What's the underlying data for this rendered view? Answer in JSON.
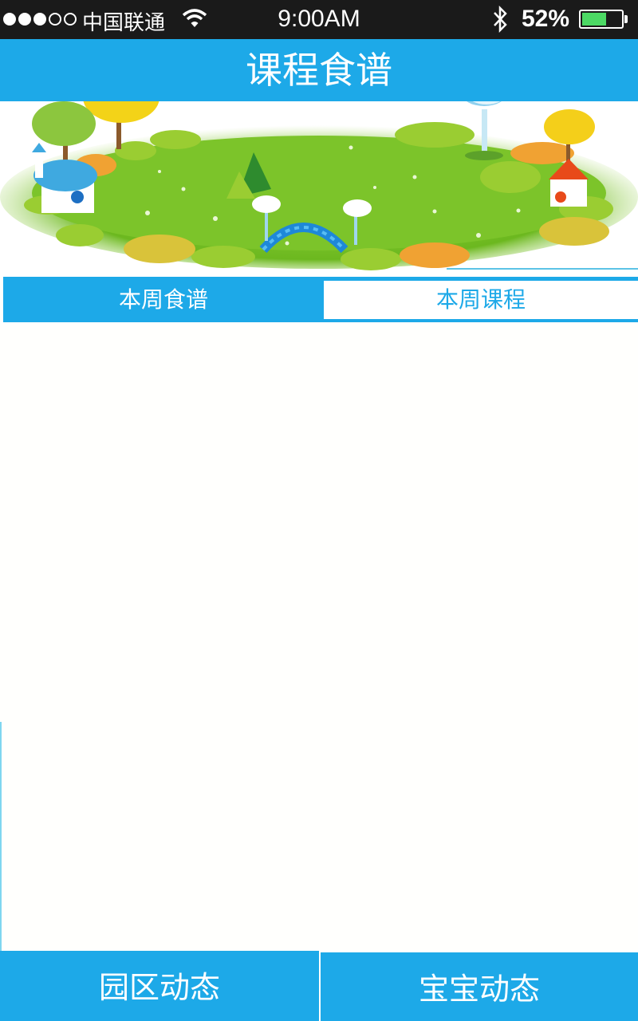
{
  "status_bar": {
    "carrier": "中国联通",
    "time": "9:00AM",
    "battery_percent": "52%",
    "battery_level": 0.62,
    "signal_bars": 3,
    "signal_total": 5
  },
  "header": {
    "title": "课程食谱"
  },
  "tabs": [
    {
      "label": "本周食谱",
      "active": true
    },
    {
      "label": "本周课程",
      "active": false
    }
  ],
  "bottom_nav": {
    "left_label": "园区动态",
    "right_label": "宝宝动态"
  },
  "colors": {
    "accent": "#1da9e8",
    "status_bar_bg": "#1a1a1a",
    "battery_fill": "#4cd964"
  }
}
